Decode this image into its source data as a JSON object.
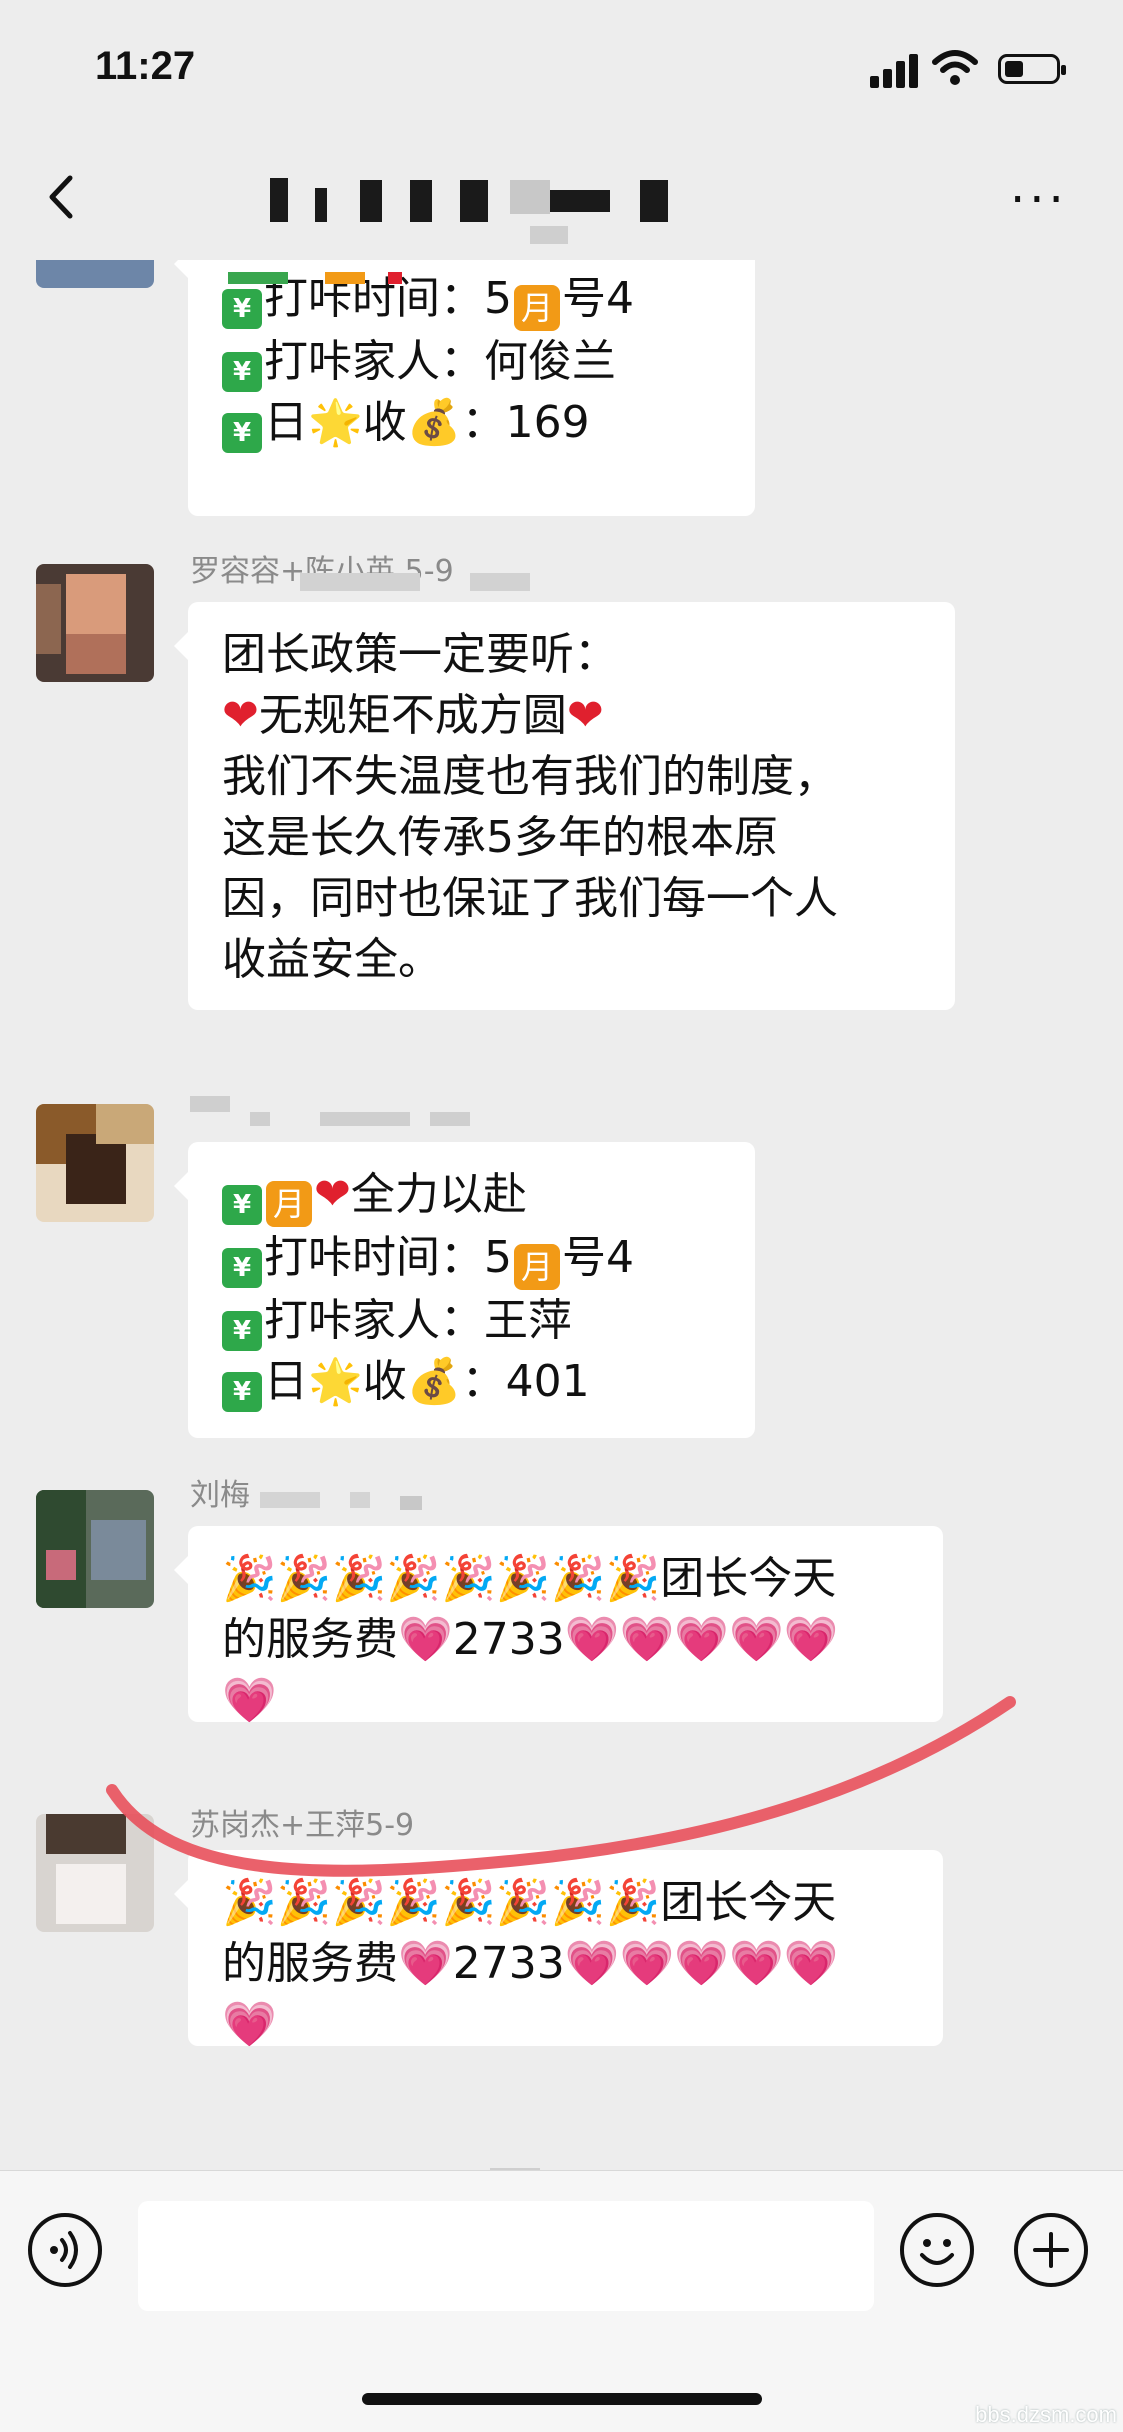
{
  "status": {
    "time": "11:27",
    "battery_level": 0.35
  },
  "nav": {
    "title": ""
  },
  "messages": [
    {
      "sender": "",
      "lines": [
        {
          "segments": [
            {
              "icon": "chart-yuan",
              "text": "💹"
            },
            {
              "text": "打咔时间：5"
            },
            {
              "icon": "month",
              "text": "月"
            },
            {
              "text": "号4"
            }
          ]
        },
        {
          "segments": [
            {
              "icon": "chart-yuan",
              "text": "💹"
            },
            {
              "text": "打咔家人：何俊兰"
            }
          ]
        },
        {
          "segments": [
            {
              "icon": "chart-yuan",
              "text": "💹"
            },
            {
              "text": "日"
            },
            {
              "icon": "star",
              "text": "🌟"
            },
            {
              "text": "收"
            },
            {
              "icon": "money-bag",
              "text": "💰"
            },
            {
              "text": "：169"
            }
          ]
        }
      ]
    },
    {
      "sender": "罗容容+陈小英 5-9",
      "lines": [
        {
          "segments": [
            {
              "text": "团长政策一定要听："
            }
          ]
        },
        {
          "segments": [
            {
              "icon": "heart",
              "text": "❤"
            },
            {
              "text": "无规矩不成方圆"
            },
            {
              "icon": "heart",
              "text": "❤"
            }
          ]
        },
        {
          "segments": [
            {
              "text": "我们不失温度也有我们的制度，"
            }
          ]
        },
        {
          "segments": [
            {
              "text": "这是长久传承5多年的根本原"
            }
          ]
        },
        {
          "segments": [
            {
              "text": "因，同时也保证了我们每一个人"
            }
          ]
        },
        {
          "segments": [
            {
              "text": "收益安全。"
            }
          ]
        }
      ]
    },
    {
      "sender": "",
      "lines": [
        {
          "segments": [
            {
              "icon": "chart-yuan",
              "text": "💹"
            },
            {
              "icon": "month",
              "text": "月"
            },
            {
              "icon": "heart",
              "text": "❤"
            },
            {
              "text": "全力以赴"
            }
          ]
        },
        {
          "segments": [
            {
              "icon": "chart-yuan",
              "text": "💹"
            },
            {
              "text": "打咔时间：5"
            },
            {
              "icon": "month",
              "text": "月"
            },
            {
              "text": "号4"
            }
          ]
        },
        {
          "segments": [
            {
              "icon": "chart-yuan",
              "text": "💹"
            },
            {
              "text": "打咔家人：王萍"
            }
          ]
        },
        {
          "segments": [
            {
              "icon": "chart-yuan",
              "text": "💹"
            },
            {
              "text": "日"
            },
            {
              "icon": "star",
              "text": "🌟"
            },
            {
              "text": "收"
            },
            {
              "icon": "money-bag",
              "text": "💰"
            },
            {
              "text": "：401"
            }
          ]
        }
      ]
    },
    {
      "sender": "刘梅",
      "lines": [
        {
          "segments": [
            {
              "icon": "party",
              "text": "🎉🎉🎉🎉🎉🎉🎉🎉"
            },
            {
              "text": "团长今天"
            }
          ]
        },
        {
          "segments": [
            {
              "text": "的服务费"
            },
            {
              "icon": "pink-heart",
              "text": "💗"
            },
            {
              "text": "2733"
            },
            {
              "icon": "pink-heart",
              "text": "💗💗💗💗💗"
            }
          ]
        },
        {
          "segments": [
            {
              "icon": "pink-heart",
              "text": "💗"
            }
          ]
        }
      ]
    },
    {
      "sender": "苏岗杰+王萍5-9",
      "lines": [
        {
          "segments": [
            {
              "icon": "party",
              "text": "🎉🎉🎉🎉🎉🎉🎉🎉"
            },
            {
              "text": "团长今天"
            }
          ]
        },
        {
          "segments": [
            {
              "text": "的服务费"
            },
            {
              "icon": "pink-heart",
              "text": "💗"
            },
            {
              "text": "2733"
            },
            {
              "icon": "pink-heart",
              "text": "💗💗💗💗💗"
            }
          ]
        },
        {
          "segments": [
            {
              "icon": "pink-heart",
              "text": "💗"
            }
          ]
        }
      ]
    }
  ],
  "input": {
    "placeholder": ""
  },
  "watermark": "bbs.dzsm.com",
  "colors": {
    "background": "#ededed",
    "bubble": "#ffffff",
    "annotation_stroke": "#e8505b"
  }
}
